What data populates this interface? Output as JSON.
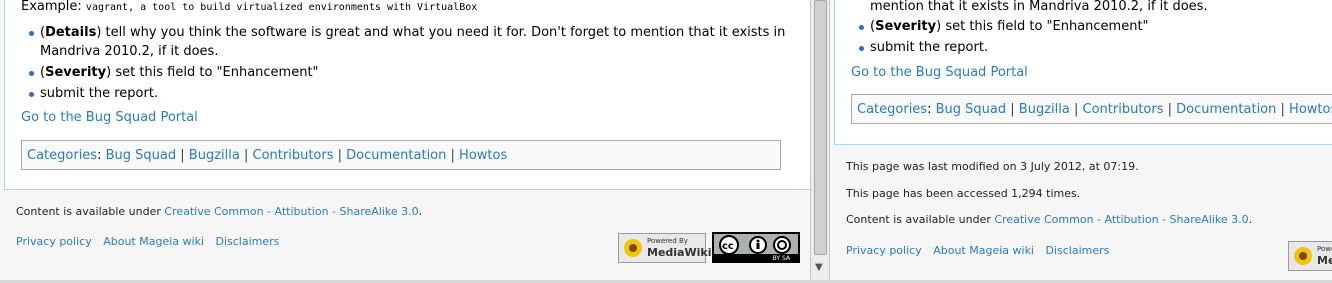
{
  "left": {
    "example_label": "Example:",
    "example_code": "vagrant, a tool to build virtualized environments with VirtualBox",
    "bullets": [
      {
        "bold": "Details",
        "line1": ") tell why you think the software is great and what you need it for. Don't forget to mention that it exists in",
        "line2": "Mandriva 2010.2, if it does."
      },
      {
        "bold": "Severity",
        "line1": ") set this field to \"Enhancement\""
      },
      {
        "line1": "submit the report."
      }
    ],
    "portal_link": "Go to the Bug Squad Portal",
    "categories_label": "Categories",
    "categories": [
      "Bug Squad",
      "Bugzilla",
      "Contributors",
      "Documentation",
      "Howtos"
    ],
    "footer": {
      "content_prefix": "Content is available under ",
      "license_link": "Creative Common - Attibution - ShareAlike 3.0",
      "links": [
        "Privacy policy",
        "About Mageia wiki",
        "Disclaimers"
      ]
    }
  },
  "right": {
    "partial_line": "mention that it exists in Mandriva 2010.2, if it does.",
    "bullets": [
      {
        "bold": "Severity",
        "line1": ") set this field to \"Enhancement\""
      },
      {
        "line1": "submit the report."
      }
    ],
    "portal_link": "Go to the Bug Squad Portal",
    "categories_label": "Categories",
    "categories": [
      "Bug Squad",
      "Bugzilla",
      "Contributors",
      "Documentation",
      "Howtos"
    ],
    "footer": {
      "last_modified": "This page was last modified on 3 July 2012, at 07:19.",
      "accessed": "This page has been accessed 1,294 times.",
      "content_prefix": "Content is available under ",
      "license_link": "Creative Common - Attibution - ShareAlike 3.0",
      "links": [
        "Privacy policy",
        "About Mageia wiki",
        "Disclaimers"
      ]
    }
  },
  "badges": {
    "mediawiki_top": "Powered By",
    "mediawiki_bottom": "MediaWiki",
    "cc_text": "BY  SA"
  },
  "colors": {
    "link": "#2a7bc0",
    "content_border": "#a7d7f9",
    "bullet": "#3366cc"
  }
}
